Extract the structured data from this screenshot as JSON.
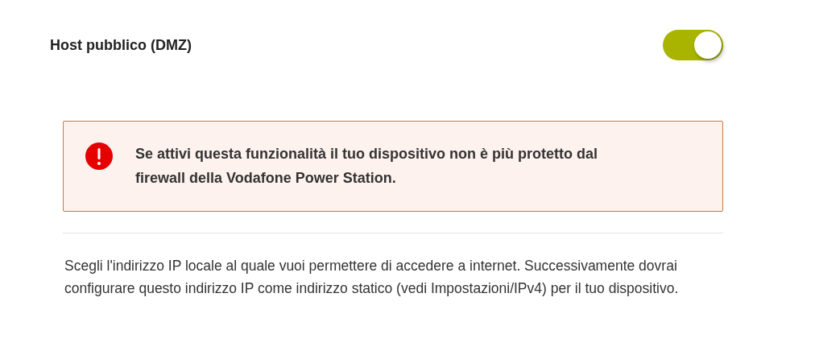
{
  "setting": {
    "title": "Host pubblico (DMZ)",
    "on": true
  },
  "alert": {
    "kind": "error",
    "message": "Se attivi questa funzionalità il tuo dispositivo non è più protetto dal firewall della Vodafone Power Station."
  },
  "description": "Scegli l'indirizzo IP locale al quale vuoi permettere di accedere a internet. Successivamente dovrai configurare questo indirizzo IP come indirizzo statico (vedi Impostazioni/IPv4) per il tuo dispositivo."
}
